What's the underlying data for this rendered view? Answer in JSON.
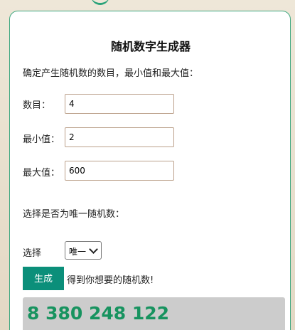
{
  "title": "随机数字生成器",
  "intro": "确定产生随机数的数目，最小值和最大值：",
  "fields": {
    "count": {
      "label": "数目：",
      "value": "4"
    },
    "min": {
      "label": "最小值：",
      "value": "2"
    },
    "max": {
      "label": "最大值：",
      "value": "600"
    }
  },
  "unique": {
    "question": "选择是否为唯一随机数：",
    "label": "选择",
    "selected": "唯一"
  },
  "generate": {
    "button_label": "生成",
    "hint": "得到你想要的随机数!"
  },
  "result": "8 380 248 122",
  "colors": {
    "accent": "#0b8f7a",
    "result_text": "#17935f",
    "card_border": "#3da77f"
  }
}
